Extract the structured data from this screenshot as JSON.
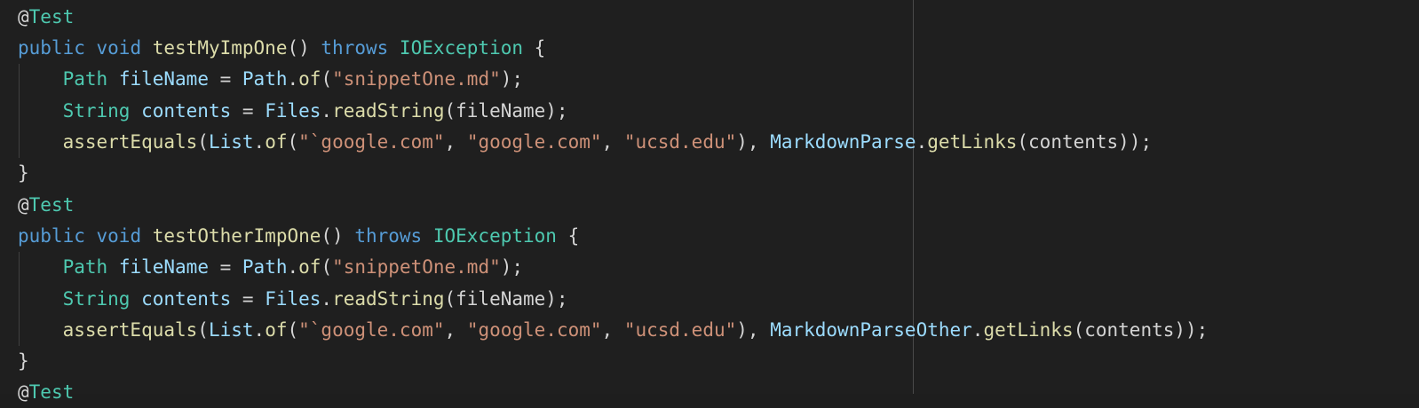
{
  "editor": {
    "lines": [
      [
        {
          "t": "@",
          "c": "plain"
        },
        {
          "t": "Test",
          "c": "type"
        }
      ],
      [
        {
          "t": "public",
          "c": "kw"
        },
        {
          "t": " ",
          "c": "plain"
        },
        {
          "t": "void",
          "c": "kw"
        },
        {
          "t": " ",
          "c": "plain"
        },
        {
          "t": "testMyImpOne",
          "c": "fn"
        },
        {
          "t": "() ",
          "c": "plain"
        },
        {
          "t": "throws",
          "c": "kw"
        },
        {
          "t": " ",
          "c": "plain"
        },
        {
          "t": "IOException",
          "c": "type"
        },
        {
          "t": " {",
          "c": "plain"
        }
      ],
      [
        {
          "t": "    ",
          "c": "plain"
        },
        {
          "t": "Path",
          "c": "type"
        },
        {
          "t": " ",
          "c": "plain"
        },
        {
          "t": "fileName",
          "c": "var"
        },
        {
          "t": " = ",
          "c": "plain"
        },
        {
          "t": "Path",
          "c": "var"
        },
        {
          "t": ".",
          "c": "plain"
        },
        {
          "t": "of",
          "c": "fn"
        },
        {
          "t": "(",
          "c": "plain"
        },
        {
          "t": "\"snippetOne.md\"",
          "c": "str"
        },
        {
          "t": ");",
          "c": "plain"
        }
      ],
      [
        {
          "t": "    ",
          "c": "plain"
        },
        {
          "t": "String",
          "c": "type"
        },
        {
          "t": " ",
          "c": "plain"
        },
        {
          "t": "contents",
          "c": "var"
        },
        {
          "t": " = ",
          "c": "plain"
        },
        {
          "t": "Files",
          "c": "var"
        },
        {
          "t": ".",
          "c": "plain"
        },
        {
          "t": "readString",
          "c": "fn"
        },
        {
          "t": "(fileName);",
          "c": "plain"
        }
      ],
      [
        {
          "t": "    ",
          "c": "plain"
        },
        {
          "t": "assertEquals",
          "c": "fn"
        },
        {
          "t": "(",
          "c": "plain"
        },
        {
          "t": "List",
          "c": "var"
        },
        {
          "t": ".",
          "c": "plain"
        },
        {
          "t": "of",
          "c": "fn"
        },
        {
          "t": "(",
          "c": "plain"
        },
        {
          "t": "\"`google.com\"",
          "c": "str"
        },
        {
          "t": ", ",
          "c": "plain"
        },
        {
          "t": "\"google.com\"",
          "c": "str"
        },
        {
          "t": ", ",
          "c": "plain"
        },
        {
          "t": "\"ucsd.edu\"",
          "c": "str"
        },
        {
          "t": "), ",
          "c": "plain"
        },
        {
          "t": "MarkdownParse",
          "c": "var"
        },
        {
          "t": ".",
          "c": "plain"
        },
        {
          "t": "getLinks",
          "c": "fn"
        },
        {
          "t": "(contents));",
          "c": "plain"
        }
      ],
      [
        {
          "t": "}",
          "c": "plain"
        }
      ],
      [
        {
          "t": "@",
          "c": "plain"
        },
        {
          "t": "Test",
          "c": "type"
        }
      ],
      [
        {
          "t": "public",
          "c": "kw"
        },
        {
          "t": " ",
          "c": "plain"
        },
        {
          "t": "void",
          "c": "kw"
        },
        {
          "t": " ",
          "c": "plain"
        },
        {
          "t": "testOtherImpOne",
          "c": "fn"
        },
        {
          "t": "() ",
          "c": "plain"
        },
        {
          "t": "throws",
          "c": "kw"
        },
        {
          "t": " ",
          "c": "plain"
        },
        {
          "t": "IOException",
          "c": "type"
        },
        {
          "t": " {",
          "c": "plain"
        }
      ],
      [
        {
          "t": "    ",
          "c": "plain"
        },
        {
          "t": "Path",
          "c": "type"
        },
        {
          "t": " ",
          "c": "plain"
        },
        {
          "t": "fileName",
          "c": "var"
        },
        {
          "t": " = ",
          "c": "plain"
        },
        {
          "t": "Path",
          "c": "var"
        },
        {
          "t": ".",
          "c": "plain"
        },
        {
          "t": "of",
          "c": "fn"
        },
        {
          "t": "(",
          "c": "plain"
        },
        {
          "t": "\"snippetOne.md\"",
          "c": "str"
        },
        {
          "t": ");",
          "c": "plain"
        }
      ],
      [
        {
          "t": "    ",
          "c": "plain"
        },
        {
          "t": "String",
          "c": "type"
        },
        {
          "t": " ",
          "c": "plain"
        },
        {
          "t": "contents",
          "c": "var"
        },
        {
          "t": " = ",
          "c": "plain"
        },
        {
          "t": "Files",
          "c": "var"
        },
        {
          "t": ".",
          "c": "plain"
        },
        {
          "t": "readString",
          "c": "fn"
        },
        {
          "t": "(fileName);",
          "c": "plain"
        }
      ],
      [
        {
          "t": "    ",
          "c": "plain"
        },
        {
          "t": "assertEquals",
          "c": "fn"
        },
        {
          "t": "(",
          "c": "plain"
        },
        {
          "t": "List",
          "c": "var"
        },
        {
          "t": ".",
          "c": "plain"
        },
        {
          "t": "of",
          "c": "fn"
        },
        {
          "t": "(",
          "c": "plain"
        },
        {
          "t": "\"`google.com\"",
          "c": "str"
        },
        {
          "t": ", ",
          "c": "plain"
        },
        {
          "t": "\"google.com\"",
          "c": "str"
        },
        {
          "t": ", ",
          "c": "plain"
        },
        {
          "t": "\"ucsd.edu\"",
          "c": "str"
        },
        {
          "t": "), ",
          "c": "plain"
        },
        {
          "t": "MarkdownParseOther",
          "c": "var"
        },
        {
          "t": ".",
          "c": "plain"
        },
        {
          "t": "getLinks",
          "c": "fn"
        },
        {
          "t": "(contents));",
          "c": "plain"
        }
      ],
      [
        {
          "t": "}",
          "c": "plain"
        }
      ],
      [
        {
          "t": "@",
          "c": "plain"
        },
        {
          "t": "Test",
          "c": "type"
        }
      ]
    ]
  },
  "colors": {
    "background": "#1f1f1f",
    "keyword": "#569cd6",
    "type": "#4ec9b0",
    "function": "#dcdcaa",
    "variable": "#9cdcfe",
    "string": "#ce9178",
    "plain": "#d4d4d4"
  }
}
